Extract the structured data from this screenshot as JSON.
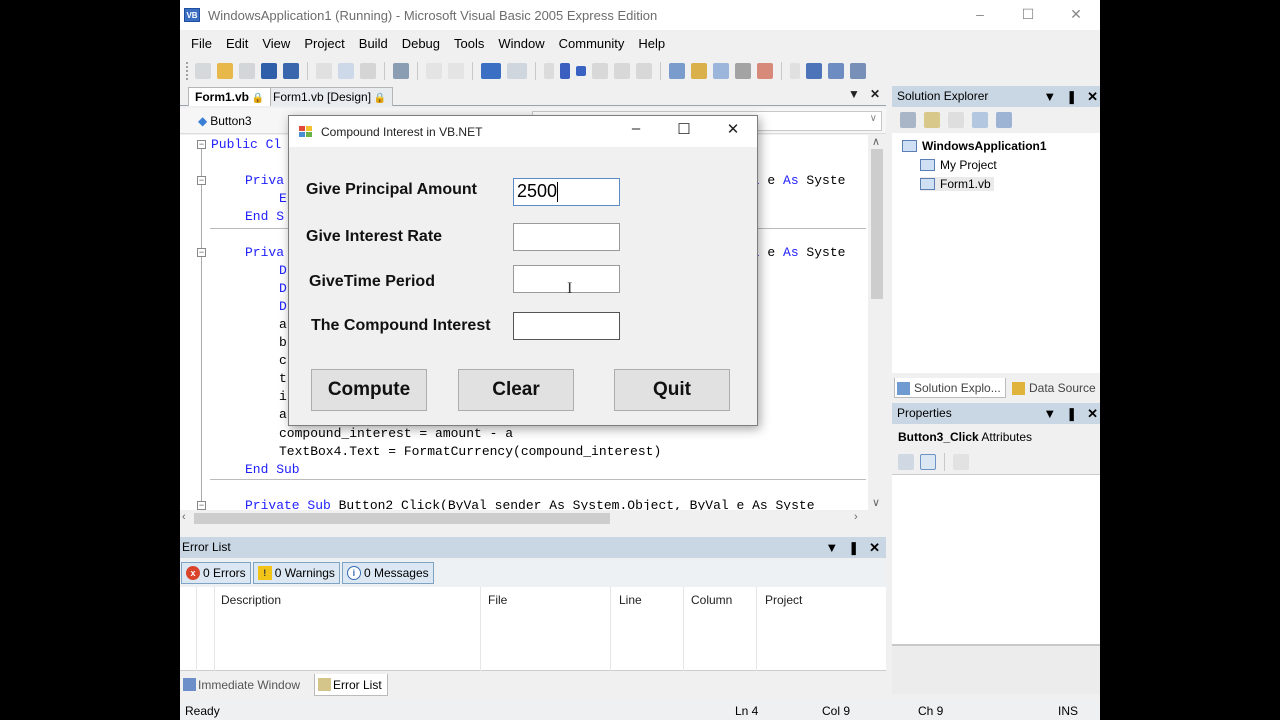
{
  "window": {
    "title": "WindowsApplication1 (Running) - Microsoft Visual Basic 2005 Express Edition",
    "app_icon": "vb-icon",
    "controls": [
      "minimize-icon",
      "maximize-icon",
      "close-icon"
    ]
  },
  "menu": [
    "File",
    "Edit",
    "View",
    "Project",
    "Build",
    "Debug",
    "Tools",
    "Window",
    "Community",
    "Help"
  ],
  "toolbar": {
    "icons": [
      "new-project-icon",
      "open-folder-icon",
      "add-item-icon",
      "save-icon",
      "save-all-icon",
      "cut-icon",
      "copy-icon",
      "paste-icon",
      "find-icon",
      "comment-icon",
      "uncomment-icon",
      "undo-icon",
      "redo-icon",
      "start-icon",
      "pause-icon",
      "stop-icon",
      "step-into-icon",
      "step-over-icon",
      "step-out-icon",
      "find-symbol-icon",
      "object-browser-icon",
      "toolbox-icon",
      "tools-icon",
      "errors-icon",
      "next-icon",
      "bookmark-icon",
      "properties-icon",
      "window-icon"
    ]
  },
  "document_tabs": [
    {
      "label": "Form1.vb",
      "active": true,
      "locked": true
    },
    {
      "label": "Form1.vb [Design]",
      "active": false,
      "locked": true
    }
  ],
  "code_nav": {
    "object": "Button3",
    "member": ""
  },
  "code": {
    "lines": [
      {
        "indent": 0,
        "kw": "Public Cl",
        "rest": ""
      },
      {
        "indent": 1,
        "kw": "Priva",
        "rest": "",
        "right": "al e As Syste"
      },
      {
        "indent": 2,
        "kw": "E",
        "rest": ""
      },
      {
        "indent": 1,
        "kw": "End S",
        "rest": ""
      },
      {
        "indent": 1,
        "kw": "Priva",
        "rest": "",
        "right": "al e As Syste"
      },
      {
        "indent": 2,
        "kw": "D",
        "rest": ""
      },
      {
        "indent": 2,
        "kw": "D",
        "rest": ""
      },
      {
        "indent": 2,
        "kw": "D",
        "rest": ""
      },
      {
        "indent": 2,
        "kw": "",
        "rest": "a"
      },
      {
        "indent": 2,
        "kw": "",
        "rest": "b"
      },
      {
        "indent": 2,
        "kw": "",
        "rest": "c"
      },
      {
        "indent": 2,
        "kw": "",
        "rest": "t"
      },
      {
        "indent": 2,
        "kw": "",
        "rest": "i"
      },
      {
        "indent": 2,
        "kw": "",
        "rest": "a"
      },
      {
        "indent": 2,
        "kw": "",
        "rest": "compound_interest = amount - a"
      },
      {
        "indent": 2,
        "kw": "",
        "rest": "TextBox4.Text = FormatCurrency(compound_interest)"
      },
      {
        "indent": 1,
        "kw": "End Sub",
        "rest": ""
      },
      {
        "indent": 1,
        "kw": "Private Sub",
        "rest": " Button2_Click(ByVal sender As System.Object, ByVal e As Syste"
      }
    ]
  },
  "error_list": {
    "title": "Error List",
    "filters": [
      {
        "label": "0 Errors",
        "icon": "error-icon"
      },
      {
        "label": "0 Warnings",
        "icon": "warning-icon"
      },
      {
        "label": "0 Messages",
        "icon": "info-icon"
      }
    ],
    "columns": [
      "Description",
      "File",
      "Line",
      "Column",
      "Project"
    ]
  },
  "bottom_tabs": [
    {
      "label": "Immediate Window",
      "active": false
    },
    {
      "label": "Error List",
      "active": true
    }
  ],
  "status": {
    "text": "Ready",
    "ln": "Ln 4",
    "col": "Col 9",
    "ch": "Ch 9",
    "mode": "INS"
  },
  "solution_explorer": {
    "title": "Solution Explorer",
    "tree": [
      {
        "label": "WindowsApplication1",
        "bold": true
      },
      {
        "label": "My Project",
        "bold": false
      },
      {
        "label": "Form1.vb",
        "bold": false
      }
    ],
    "tabs": [
      "Solution Explo...",
      "Data Source"
    ]
  },
  "properties": {
    "title": "Properties",
    "object": "Button3_Click",
    "object_type": "Attributes"
  },
  "dialog": {
    "title": "Compound Interest in VB.NET",
    "fields": [
      {
        "label": "Give Principal Amount",
        "value": "2500"
      },
      {
        "label": "Give Interest Rate",
        "value": ""
      },
      {
        "label": "GiveTime Period",
        "value": ""
      },
      {
        "label": "The Compound Interest",
        "value": ""
      }
    ],
    "buttons": {
      "compute": "Compute",
      "clear": "Clear",
      "quit": "Quit"
    }
  }
}
